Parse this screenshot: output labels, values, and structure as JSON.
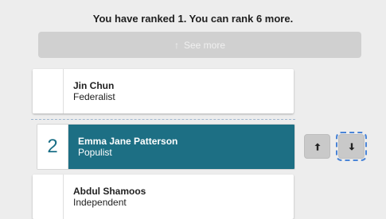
{
  "status": {
    "message": "You have ranked 1. You can rank 6 more."
  },
  "see_more": {
    "label": "See more",
    "icon": "arrow-up-icon"
  },
  "candidates": [
    {
      "rank": "",
      "name": "Jin Chun",
      "party": "Federalist"
    },
    {
      "rank": "2",
      "name": "Emma Jane Patterson",
      "party": "Populist"
    },
    {
      "rank": "",
      "name": "Abdul Shamoos",
      "party": "Independent"
    }
  ],
  "controls": {
    "move_up_icon": "arrow-up-icon",
    "move_down_icon": "arrow-down-icon"
  },
  "colors": {
    "accent": "#1D6F84",
    "background": "#EDEDED",
    "focus_ring": "#4A84D6"
  }
}
